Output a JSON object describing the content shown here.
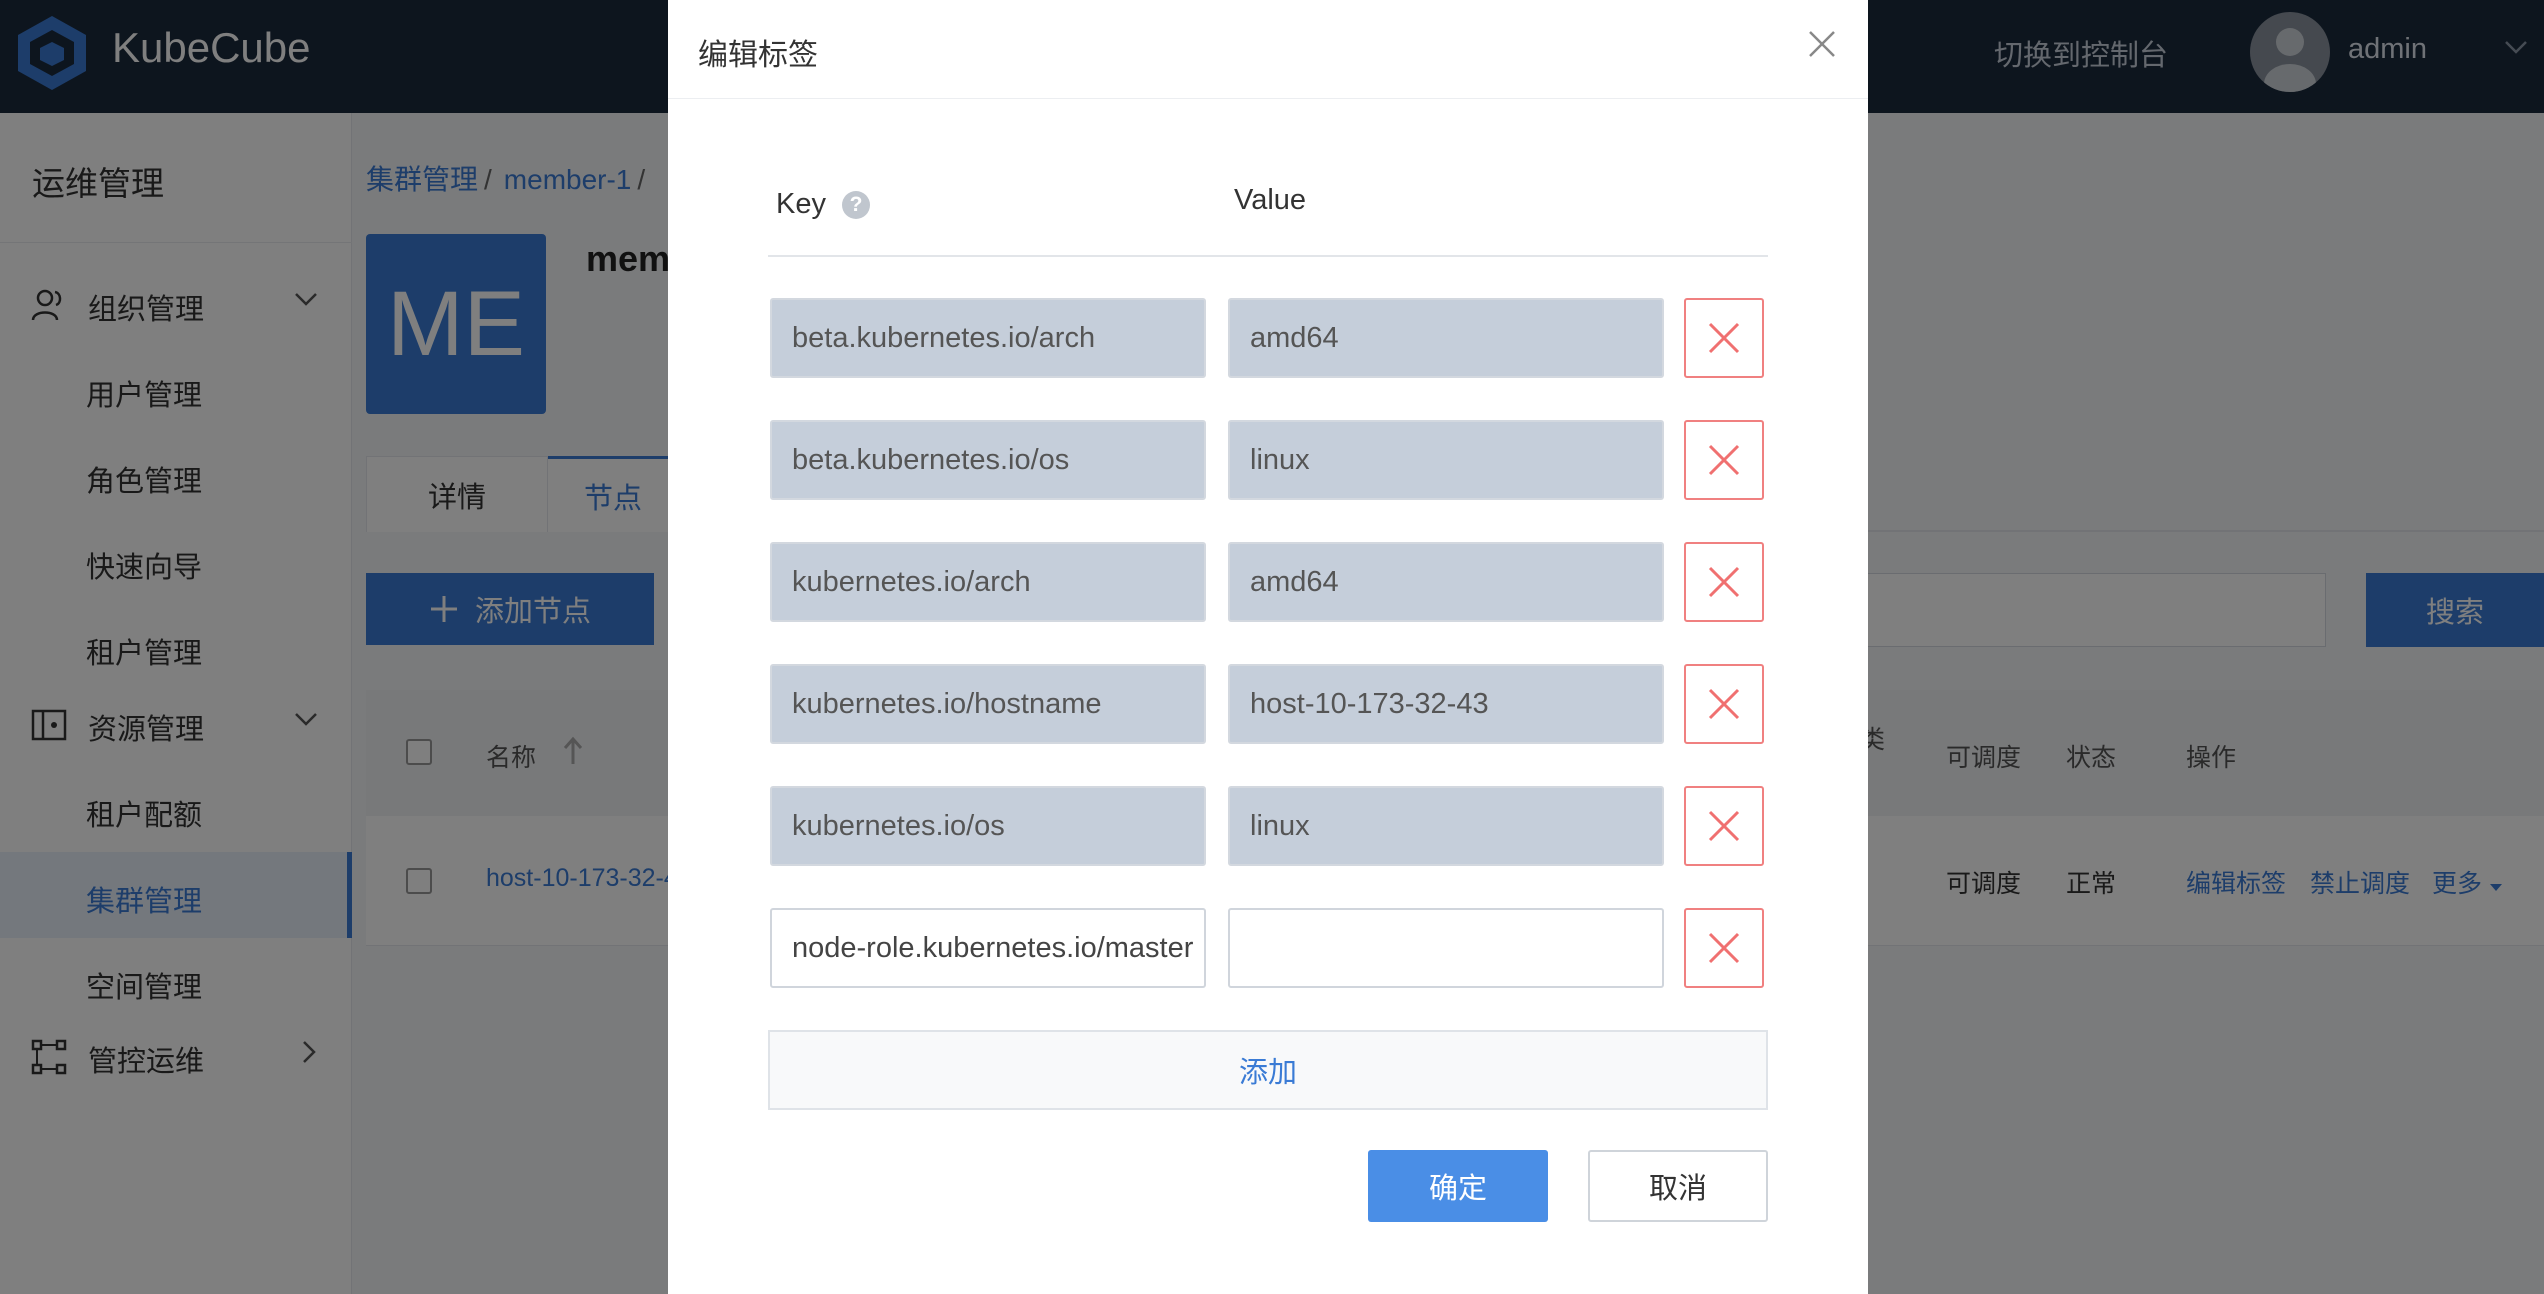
{
  "app": {
    "name": "KubeCube",
    "switch_console": "切换到控制台",
    "username": "admin"
  },
  "sidebar": {
    "title": "运维管理",
    "groups": [
      {
        "label": "组织管理",
        "icon": "users-icon",
        "items": [
          "用户管理",
          "角色管理",
          "快速向导",
          "租户管理"
        ]
      },
      {
        "label": "资源管理",
        "icon": "resource-icon",
        "items": [
          "租户配额",
          "集群管理",
          "空间管理"
        ]
      },
      {
        "label": "管控运维",
        "icon": "ops-icon",
        "items": []
      }
    ],
    "active_item": "集群管理"
  },
  "main": {
    "breadcrumb": [
      "集群管理",
      "member-1"
    ],
    "avatar_text": "ME",
    "cluster_name_partial": "mem",
    "tabs": [
      "详情",
      "节点"
    ],
    "add_node_label": "添加节点",
    "search_label": "搜索",
    "table": {
      "headers": [
        "名称",
        "类",
        "可调度",
        "状态",
        "操作"
      ],
      "rows": [
        {
          "name": "host-10-173-32-4",
          "schedulable": "可调度",
          "status": "正常",
          "actions": [
            "编辑标签",
            "禁止调度",
            "更多"
          ]
        }
      ]
    }
  },
  "modal": {
    "title": "编辑标签",
    "key_header": "Key",
    "value_header": "Value",
    "labels": [
      {
        "key": "beta.kubernetes.io/arch",
        "value": "amd64",
        "editable": false
      },
      {
        "key": "beta.kubernetes.io/os",
        "value": "linux",
        "editable": false
      },
      {
        "key": "kubernetes.io/arch",
        "value": "amd64",
        "editable": false
      },
      {
        "key": "kubernetes.io/hostname",
        "value": "host-10-173-32-43",
        "editable": false
      },
      {
        "key": "kubernetes.io/os",
        "value": "linux",
        "editable": false
      },
      {
        "key": "node-role.kubernetes.io/master",
        "value": "",
        "editable": true
      }
    ],
    "add_label": "添加",
    "confirm_label": "确定",
    "cancel_label": "取消"
  },
  "colors": {
    "topbar": "#1b2a3d",
    "accent": "#3a7bd5",
    "delete": "#f08080",
    "readonly_field": "#c5ceda"
  }
}
